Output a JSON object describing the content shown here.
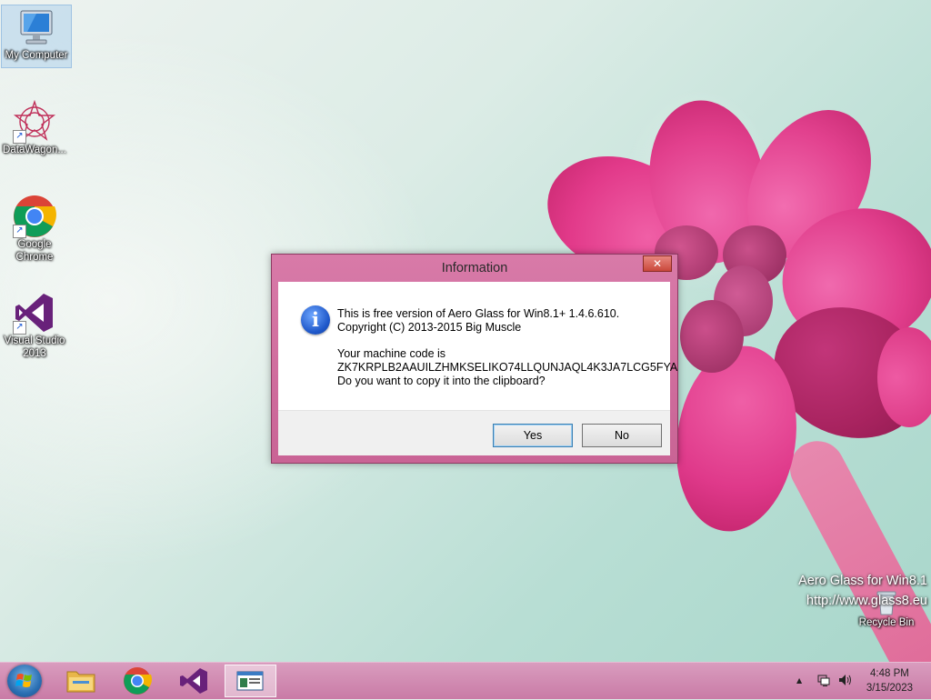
{
  "desktop": {
    "icons": [
      {
        "label": "My Computer",
        "icon": "computer-icon"
      },
      {
        "label": "DataWagon...",
        "icon": "datawagon-icon"
      },
      {
        "label": "Google Chrome",
        "icon": "chrome-icon"
      },
      {
        "label": "Visual Studio 2013",
        "icon": "visual-studio-icon"
      },
      {
        "label": "Recycle Bin",
        "icon": "recycle-bin-icon"
      }
    ],
    "watermark": {
      "line1": "Aero Glass for Win8.1",
      "line2": "http://www.glass8.eu"
    }
  },
  "dialog": {
    "title": "Information",
    "close_label": "✕",
    "icon": "information-icon",
    "message": {
      "line1": "This is free version of Aero Glass for Win8.1+ 1.4.6.610.",
      "line2": "Copyright (C) 2013-2015 Big Muscle",
      "line3": "Your machine code is",
      "line4": "ZK7KRPLB2AAUILZHMKSELIKO74LLQUNJAQL4K3JA7LCG5FYA",
      "line5": "Do you want to copy it into the clipboard?"
    },
    "buttons": {
      "yes": "Yes",
      "no": "No"
    }
  },
  "taskbar": {
    "pinned": [
      "start-button",
      "file-explorer-icon",
      "chrome-icon",
      "visual-studio-icon",
      "app-window-icon"
    ],
    "tray": {
      "chevron": "▲",
      "network_icon": "network-icon",
      "volume_icon": "volume-icon"
    },
    "clock": {
      "time": "4:48 PM",
      "date": "3/15/2023"
    }
  },
  "colors": {
    "titlebar": "#d87aa8",
    "taskbar": "#d99cbe",
    "flower": "#e33a8c"
  }
}
